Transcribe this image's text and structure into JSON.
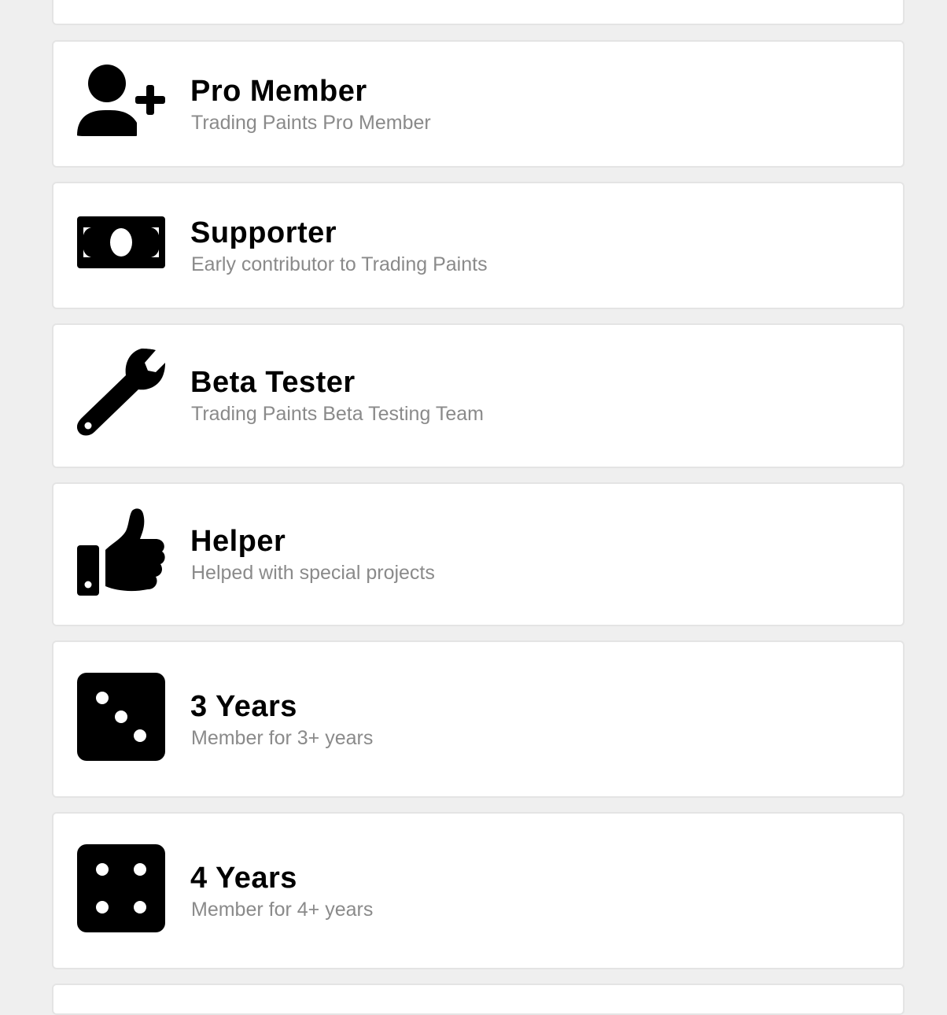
{
  "badges": [
    {
      "title": "Pro Member",
      "subtitle": "Trading Paints Pro Member",
      "icon": "user-plus-icon"
    },
    {
      "title": "Supporter",
      "subtitle": "Early contributor to Trading Paints",
      "icon": "money-bill-icon"
    },
    {
      "title": "Beta Tester",
      "subtitle": "Trading Paints Beta Testing Team",
      "icon": "wrench-icon"
    },
    {
      "title": "Helper",
      "subtitle": "Helped with special projects",
      "icon": "thumbs-up-icon"
    },
    {
      "title": "3 Years",
      "subtitle": "Member for 3+ years",
      "icon": "dice-three-icon"
    },
    {
      "title": "4 Years",
      "subtitle": "Member for 4+ years",
      "icon": "dice-four-icon"
    }
  ],
  "colors": {
    "background": "#efefef",
    "card": "#ffffff",
    "card_border": "#e4e4e4",
    "title": "#000000",
    "subtitle": "#8a8a8a"
  }
}
